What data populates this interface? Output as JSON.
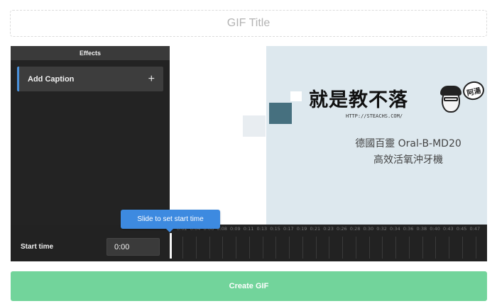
{
  "title_input": {
    "placeholder": "GIF Title",
    "value": ""
  },
  "sidebar": {
    "header": "Effects",
    "items": [
      {
        "label": "Add Caption",
        "action_icon": "+"
      }
    ]
  },
  "preview": {
    "banner_text": "就是教不落",
    "url_text": "HTTP://STEACHS.COM/",
    "badge_text": "阿湯",
    "caption_line1": "德國百靈 Oral-B-MD20",
    "caption_line2": "高效活氧沖牙機"
  },
  "controls": {
    "start_label": "Start time",
    "start_value": "0:00",
    "tooltip": "Slide to set start time",
    "slider_position": 0,
    "tick_labels": [
      "0:02",
      "0:04",
      "0:06",
      "0:08",
      "0:09",
      "0:11",
      "0:13",
      "0:15",
      "0:17",
      "0:19",
      "0:21",
      "0:23",
      "0:26",
      "0:28",
      "0:30",
      "0:32",
      "0:34",
      "0:36",
      "0:38",
      "0:40",
      "0:43",
      "0:45",
      "0:47"
    ]
  },
  "create_button": {
    "label": "Create GIF"
  },
  "colors": {
    "accent_blue": "#3d8ae0",
    "create_green": "#72d49b",
    "editor_bg": "#1f1f1f"
  }
}
